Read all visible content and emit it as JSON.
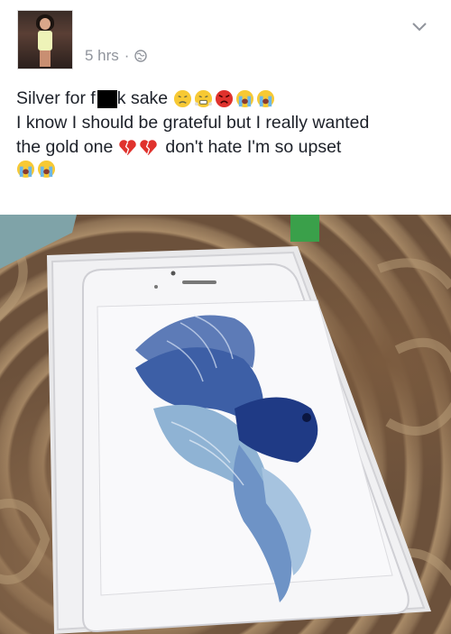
{
  "post": {
    "time": "5 hrs",
    "separator": "·",
    "privacy_icon": "globe-icon",
    "menu_icon": "chevron-down-icon",
    "line1_part1": "Silver for f",
    "line1_part2": "k sake",
    "line2": "I know I should be grateful but I really wanted",
    "line3_part1": "the gold one",
    "line3_part2": "don't hate I'm so upset",
    "emojis_line1": [
      "disappointed-face-icon",
      "triumph-face-icon",
      "angry-face-icon",
      "loudly-crying-face-icon",
      "loudly-crying-face-icon"
    ],
    "emojis_line3": [
      "broken-heart-icon",
      "broken-heart-icon"
    ],
    "emojis_line4": [
      "loudly-crying-face-icon",
      "loudly-crying-face-icon"
    ]
  },
  "colors": {
    "meta_gray": "#90949c",
    "text": "#1d2129",
    "emoji_yellow": "#f7c934",
    "heart_red": "#e0322d"
  }
}
